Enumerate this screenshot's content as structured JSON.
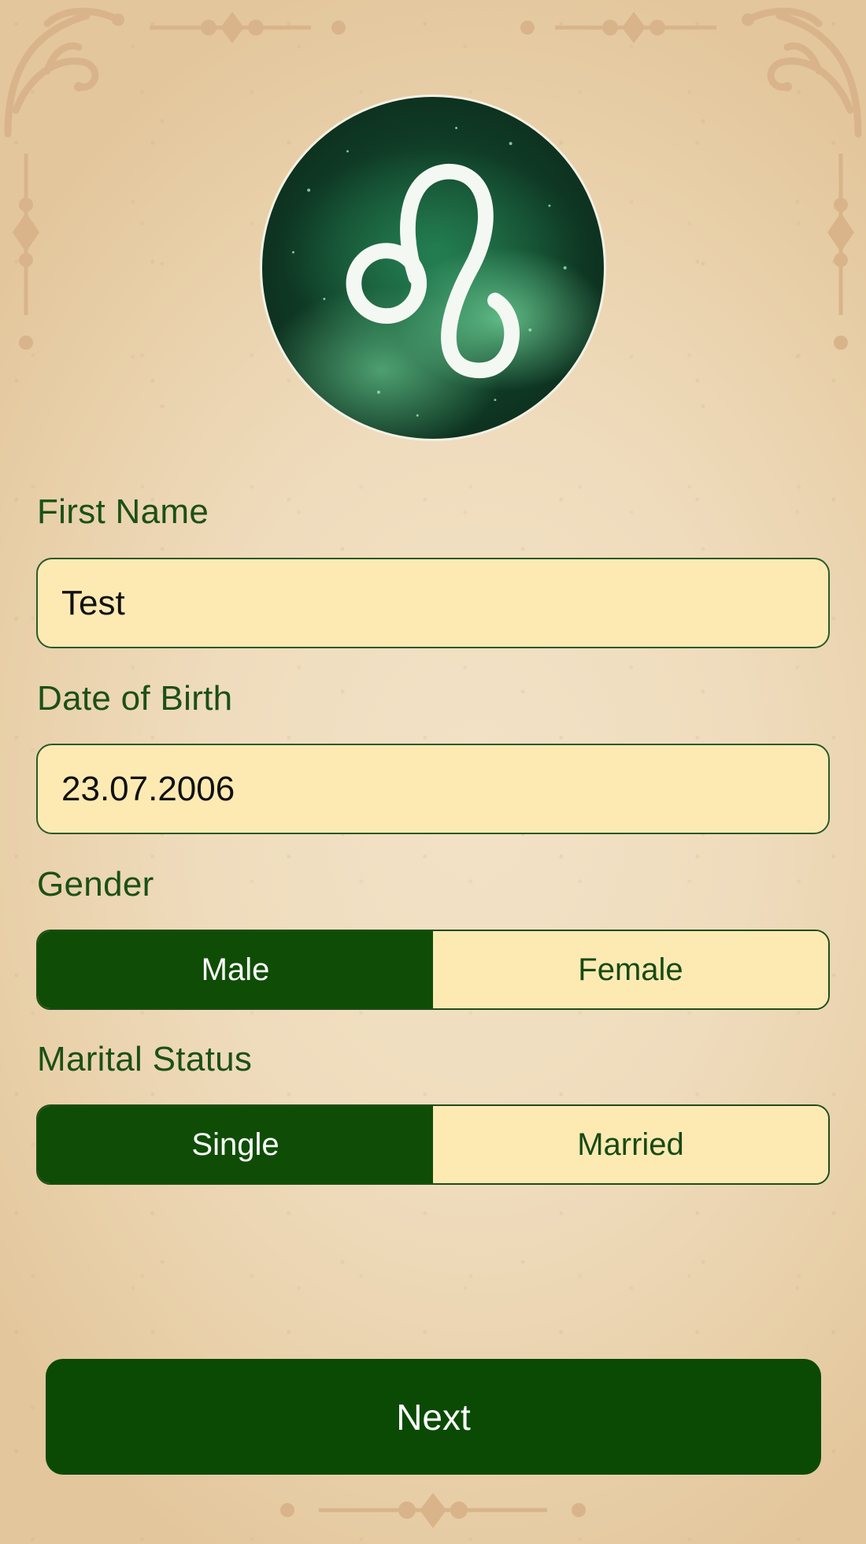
{
  "form": {
    "first_name_label": "First Name",
    "first_name_value": "Test",
    "dob_label": "Date of Birth",
    "dob_value": "23.07.2006",
    "gender_label": "Gender",
    "gender_options": [
      "Male",
      "Female"
    ],
    "gender_selected": "Male",
    "marital_label": "Marital Status",
    "marital_options": [
      "Single",
      "Married"
    ],
    "marital_selected": "Single"
  },
  "actions": {
    "next_label": "Next"
  },
  "icons": {
    "zodiac": "leo-zodiac-icon"
  },
  "colors": {
    "accent_green": "#0f4d06",
    "label_green": "#1b5016",
    "field_fill": "#fdeab3",
    "ornament": "#d9b48a"
  }
}
